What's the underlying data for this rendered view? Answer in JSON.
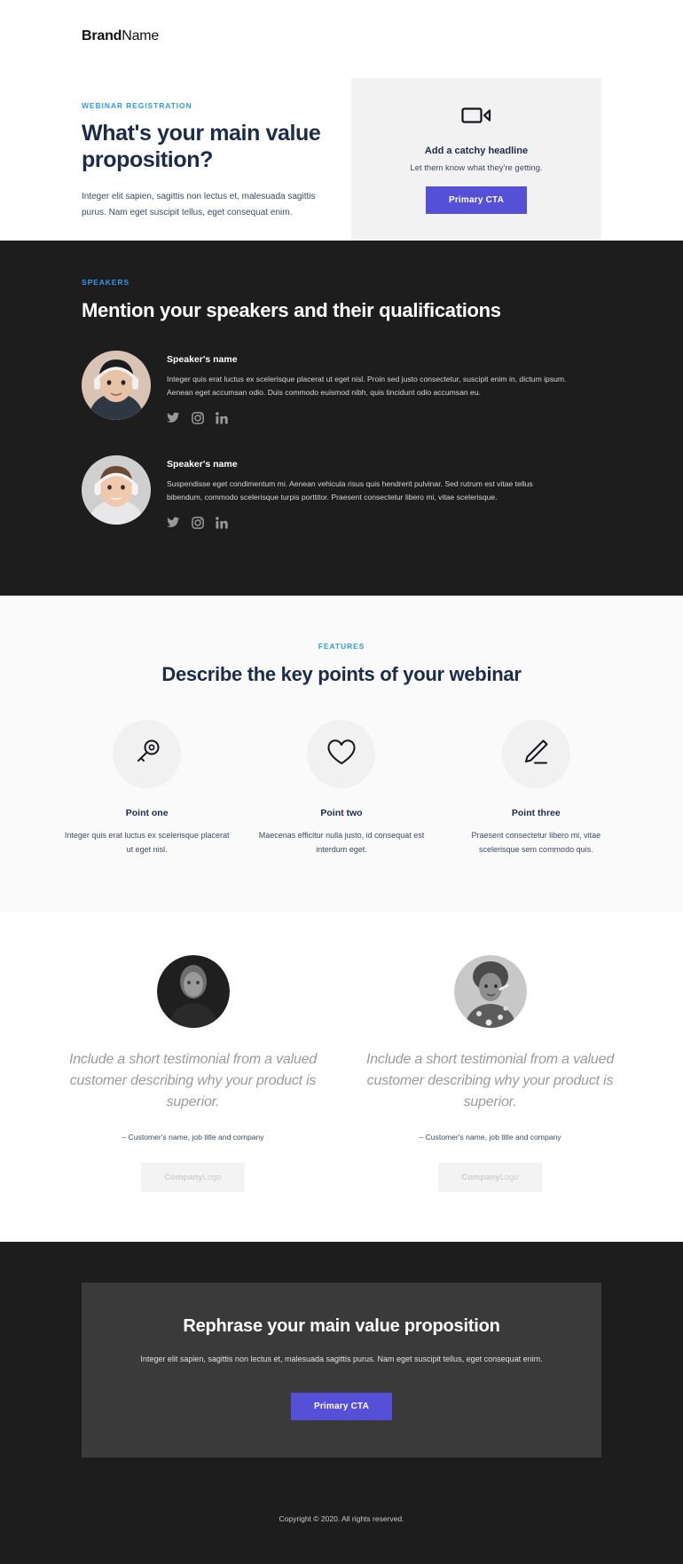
{
  "header": {
    "brand_bold": "Brand",
    "brand_light": "Name"
  },
  "hero": {
    "eyebrow": "WEBINAR REGISTRATION",
    "title": "What's your main value proposition?",
    "body": "Integer elit sapien, sagittis non lectus et, malesuada sagittis purus. Nam eget suscipit tellus, eget consequat enim.",
    "card": {
      "icon": "video-camera-icon",
      "headline": "Add a catchy headline",
      "subtext": "Let them know what they're getting.",
      "cta_label": "Primary CTA"
    }
  },
  "speakers": {
    "eyebrow": "SPEAKERS",
    "title": "Mention your speakers and their qualifications",
    "list": [
      {
        "name": "Speaker's name",
        "bio": "Integer quis erat luctus ex scelerisque placerat ut eget nisl. Proin sed justo consectetur, suscipit enim in, dictum ipsum. Aenean eget accumsan odio. Duis commodo euismod nibh, quis tincidunt odio accumsan eu.",
        "socials": [
          "twitter-icon",
          "instagram-icon",
          "linkedin-icon"
        ]
      },
      {
        "name": "Speaker's name",
        "bio": "Suspendisse eget condimentum mi. Aenean vehicula risus quis hendrerit pulvinar. Sed rutrum est vitae tellus bibendum, commodo scelerisque turpis porttitor. Praesent consectetur libero mi, vitae scelerisque.",
        "socials": [
          "twitter-icon",
          "instagram-icon",
          "linkedin-icon"
        ]
      }
    ]
  },
  "features": {
    "eyebrow": "FEATURES",
    "title": "Describe the key points of your webinar",
    "items": [
      {
        "icon": "key-icon",
        "title": "Point one",
        "body": "Integer quis erat luctus ex scelerisque placerat ut eget nisl."
      },
      {
        "icon": "heart-icon",
        "title": "Point two",
        "body": "Maecenas efficitur nulla justo, id consequat est interdum eget."
      },
      {
        "icon": "pencil-icon",
        "title": "Point three",
        "body": "Praesent consectetur libero mi, vitae scelerisque sem commodo quis."
      }
    ]
  },
  "testimonials": [
    {
      "quote": "Include a short testimonial from a valued customer describing why your product is superior.",
      "attribution": "– Customer's name, job title and company",
      "logo_bold": "Company",
      "logo_light": "Logo"
    },
    {
      "quote": "Include a short testimonial from a valued customer describing why your product is superior.",
      "attribution": "– Customer's name, job title and company",
      "logo_bold": "Company",
      "logo_light": "Logo"
    }
  ],
  "footer": {
    "cta_title": "Rephrase your main value proposition",
    "cta_body": "Integer elit sapien, sagittis non lectus et, malesuada sagittis purus. Nam eget suscipit tellus, eget consequat enim.",
    "cta_label": "Primary CTA",
    "copyright": "Copyright © 2020. All rights reserved."
  },
  "colors": {
    "accent_blue": "#2f9bed",
    "primary_purple": "#5650d9",
    "navy": "#1b2b49",
    "dark_bg": "#1d1d1d",
    "card_gray": "#3a3a3a"
  }
}
